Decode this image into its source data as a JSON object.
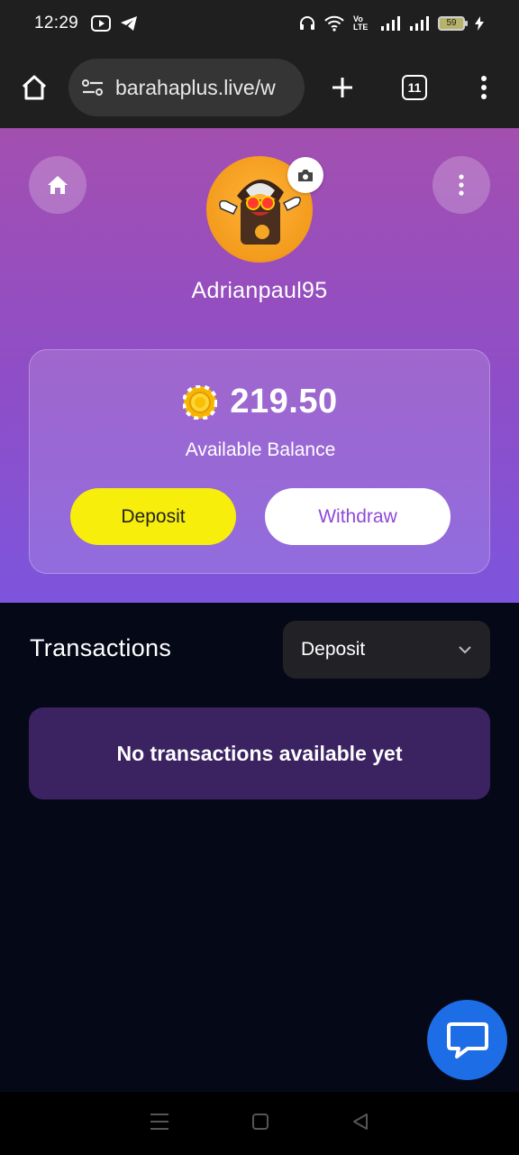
{
  "status_bar": {
    "time": "12:29",
    "network_label": "Vo LTE",
    "battery_level": "59"
  },
  "browser": {
    "url": "barahaplus.live/w",
    "tab_count": "11"
  },
  "profile": {
    "username": "Adrianpaul95"
  },
  "balance": {
    "amount": "219.50",
    "label": "Available Balance",
    "deposit_label": "Deposit",
    "withdraw_label": "Withdraw"
  },
  "transactions": {
    "title": "Transactions",
    "filter_selected": "Deposit",
    "empty_message": "No transactions available yet"
  },
  "colors": {
    "header_gradient_top": "#a34fb0",
    "header_gradient_bottom": "#7d55dc",
    "deposit_button": "#f8ee0c",
    "withdraw_text": "#8e4ad8",
    "empty_card": "#3b2362",
    "chat_button": "#1d6de6",
    "page_background": "#050816"
  },
  "icons": {
    "home": "home-icon",
    "more": "more-vertical-icon",
    "camera": "camera-icon",
    "coin": "coin-icon",
    "dropdown": "chevron-down-icon",
    "chat": "chat-bubble-icon"
  }
}
